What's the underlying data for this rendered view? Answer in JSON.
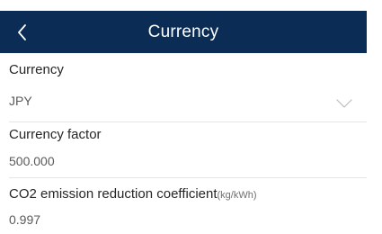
{
  "header": {
    "title": "Currency"
  },
  "currency": {
    "label": "Currency",
    "value": "JPY"
  },
  "currency_factor": {
    "label": "Currency factor",
    "value": "500.000"
  },
  "co2": {
    "label": "CO2 emission reduction coefficient",
    "unit": "(kg/kWh)",
    "value": "0.997"
  },
  "colors": {
    "header_bg": "#0b2d55",
    "header_text": "#ffffff"
  },
  "icons": {
    "back": "chevron-left-icon",
    "dropdown": "chevron-down-icon"
  }
}
